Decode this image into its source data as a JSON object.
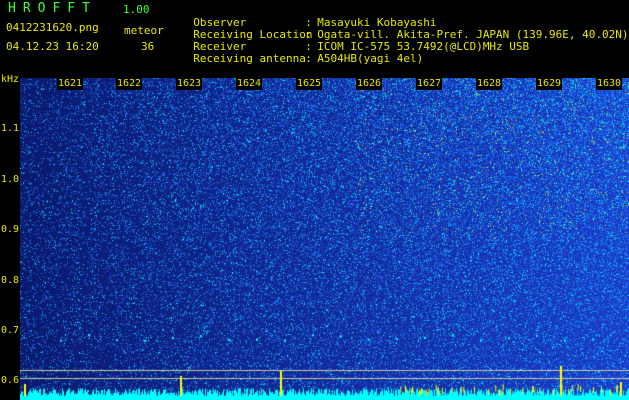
{
  "header": {
    "app_title": "HROFFT",
    "app_version": "1.00",
    "file_name": "0412231620.png",
    "meteor_label": "meteor",
    "date_time": "04.12.23 16:20",
    "meteor_count": "36"
  },
  "info": [
    {
      "key": "Observer",
      "value": "Masayuki Kobayashi"
    },
    {
      "key": "Receiving Location",
      "value": "Ogata-vill. Akita-Pref. JAPAN (139.96E, 40.02N)"
    },
    {
      "key": "Receiver",
      "value": "ICOM IC-575 53.7492(@LCD)MHz USB"
    },
    {
      "key": "Receiving antenna",
      "value": "A504HB(yagi 4el)"
    }
  ],
  "spectrogram": {
    "freq_unit": "kHz",
    "freq_ticks": [
      "1.1",
      "1.0",
      "0.9",
      "0.8",
      "0.7",
      "0.6"
    ],
    "time_labels": [
      "1621",
      "1622",
      "1623",
      "1624",
      "1625",
      "1626",
      "1627",
      "1628",
      "1629",
      "1630"
    ],
    "colors": {
      "background_low": "#0a1a6e",
      "background_high": "#1a3cc8",
      "noise": "#3a6cff",
      "signal": "#00ffff",
      "peak": "#ffff00",
      "baseline": "#00ffff"
    }
  }
}
